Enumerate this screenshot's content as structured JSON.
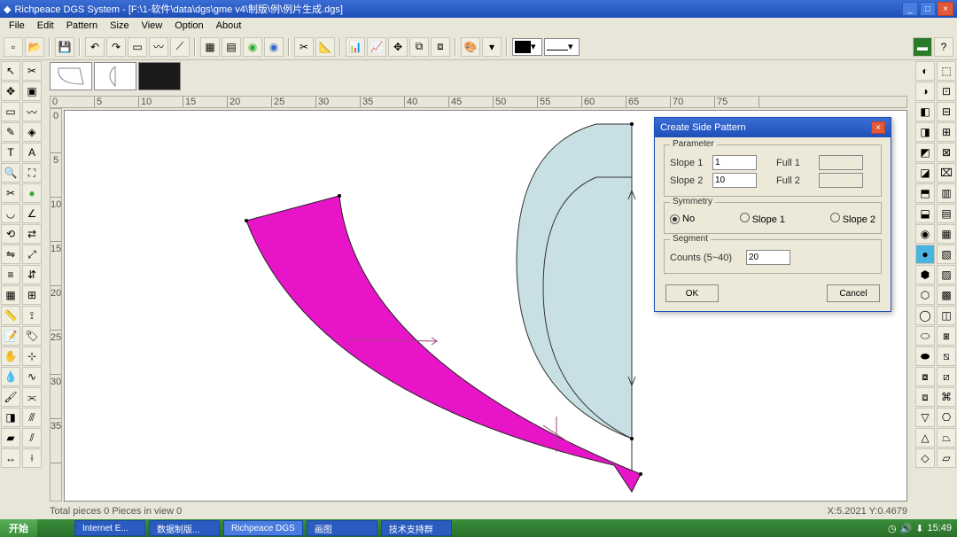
{
  "titlebar": {
    "title": "Richpeace DGS System - [F:\\1-软件\\data\\dgs\\gme v4\\制版\\例\\例片生成.dgs]"
  },
  "menu": [
    "File",
    "Edit",
    "Pattern",
    "Size",
    "View",
    "Option",
    "About"
  ],
  "thumbs_count": 3,
  "ruler_h": [
    "0",
    "5",
    "10",
    "15",
    "20",
    "25",
    "30",
    "35",
    "40",
    "45",
    "50",
    "55",
    "60",
    "65",
    "70",
    "75"
  ],
  "ruler_v": [
    "0",
    "5",
    "10",
    "15",
    "20",
    "25",
    "30",
    "35"
  ],
  "status": {
    "left": "Total pieces 0    Pieces in view 0",
    "right": "X:5.2021    Y:0.4679"
  },
  "dialog": {
    "title": "Create Side Pattern",
    "parameter": {
      "legend": "Parameter",
      "slope1_label": "Slope 1",
      "slope1_value": "1",
      "full1_label": "Full 1",
      "full1_value": "",
      "slope2_label": "Slope 2",
      "slope2_value": "10",
      "full2_label": "Full 2",
      "full2_value": ""
    },
    "symmetry": {
      "legend": "Symmetry",
      "opt_no": "No",
      "opt_s1": "Slope 1",
      "opt_s2": "Slope 2"
    },
    "segment": {
      "legend": "Segment",
      "counts_label": "Counts (5~40)",
      "counts_value": "20"
    },
    "ok": "OK",
    "cancel": "Cancel"
  },
  "taskbar": {
    "start": "开始",
    "items": [
      "Internet E...",
      "数据制版...",
      "Richpeace DGS",
      "画图",
      "技术支持群"
    ],
    "time": "15:49"
  }
}
